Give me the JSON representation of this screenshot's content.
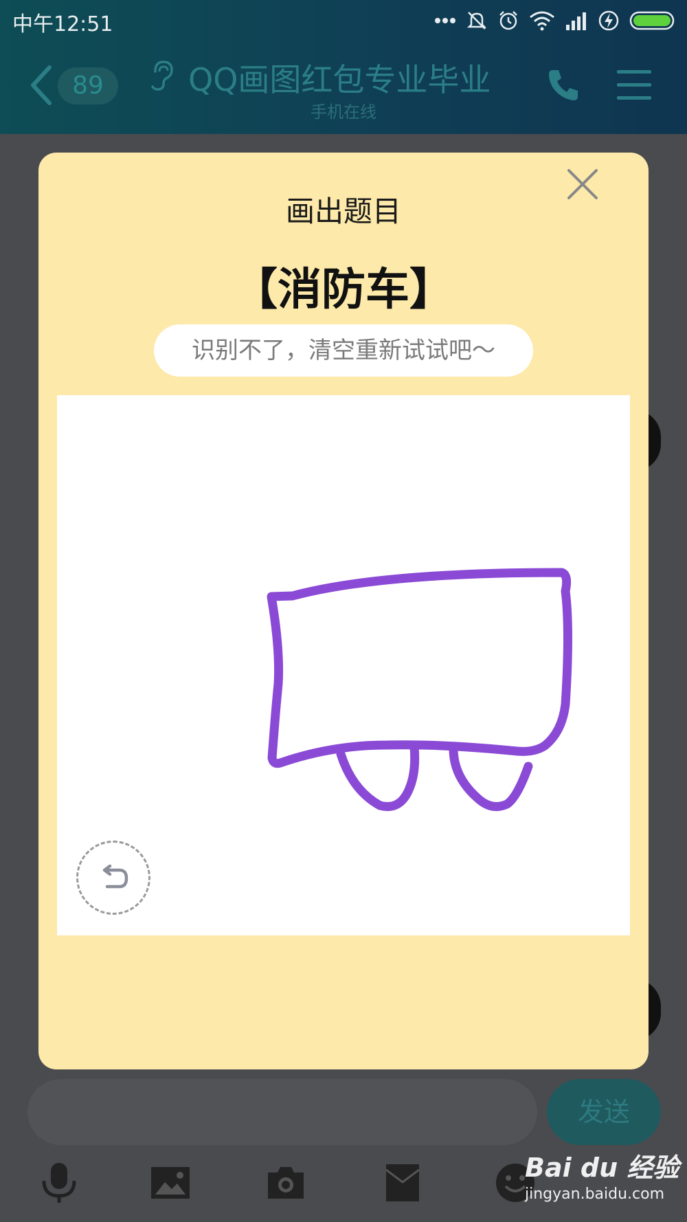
{
  "status_bar": {
    "time": "中午12:51",
    "icons": [
      "more-dots-icon",
      "mute-icon",
      "alarm-icon",
      "wifi-icon",
      "signal-icon",
      "charging-icon",
      "battery-icon"
    ]
  },
  "header": {
    "unread_count": "89",
    "title": "QQ画图红包专业毕业",
    "subtitle": "手机在线"
  },
  "modal": {
    "heading": "画出题目",
    "word": "【消防车】",
    "hint": "识别不了，清空重新试试吧～"
  },
  "input": {
    "send_label": "发送"
  },
  "toolbar": {
    "icons": [
      "microphone-icon",
      "image-icon",
      "camera-icon",
      "red-packet-icon",
      "emoji-icon"
    ]
  },
  "watermark": {
    "logo": "Bai du 经验",
    "url": "jingyan.baidu.com"
  },
  "colors": {
    "modal_bg": "#fde9aa",
    "stroke": "#8a4ad6",
    "header_bg": "#0f3f55"
  }
}
